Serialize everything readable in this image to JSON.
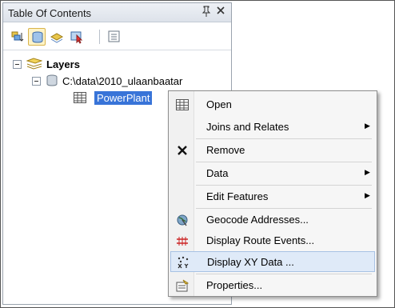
{
  "toc": {
    "title": "Table Of Contents",
    "pin_glyph": "p",
    "close_glyph": "×",
    "toolbar": [
      {
        "icon": "list-by-drawing-order-icon"
      },
      {
        "icon": "list-by-source-icon",
        "active": true
      },
      {
        "icon": "list-by-visibility-icon"
      },
      {
        "icon": "list-by-selection-icon"
      },
      {
        "icon": "options-icon"
      }
    ],
    "tree": {
      "root_label": "Layers",
      "source_label": "C:\\data\\2010_ulaanbaatar",
      "table_label": "PowerPlant"
    }
  },
  "context_menu": {
    "items": [
      {
        "label": "Open",
        "icon": "table-icon",
        "submenu": false
      },
      {
        "label": "Joins and Relates",
        "icon": "",
        "submenu": true
      },
      {
        "label": "Remove",
        "icon": "remove-x-icon",
        "submenu": false
      },
      {
        "label": "Data",
        "icon": "",
        "submenu": true
      },
      {
        "label": "Edit Features",
        "icon": "",
        "submenu": true
      },
      {
        "label": "Geocode Addresses...",
        "icon": "geocode-icon",
        "submenu": false
      },
      {
        "label": "Display Route Events...",
        "icon": "route-events-icon",
        "submenu": false
      },
      {
        "label": "Display XY Data ...",
        "icon": "xy-data-icon",
        "submenu": false,
        "highlighted": true
      },
      {
        "label": "Properties...",
        "icon": "properties-icon",
        "submenu": false
      }
    ]
  },
  "colors": {
    "selection": "#3874d8",
    "menu_highlight": "#dfeaf8"
  }
}
